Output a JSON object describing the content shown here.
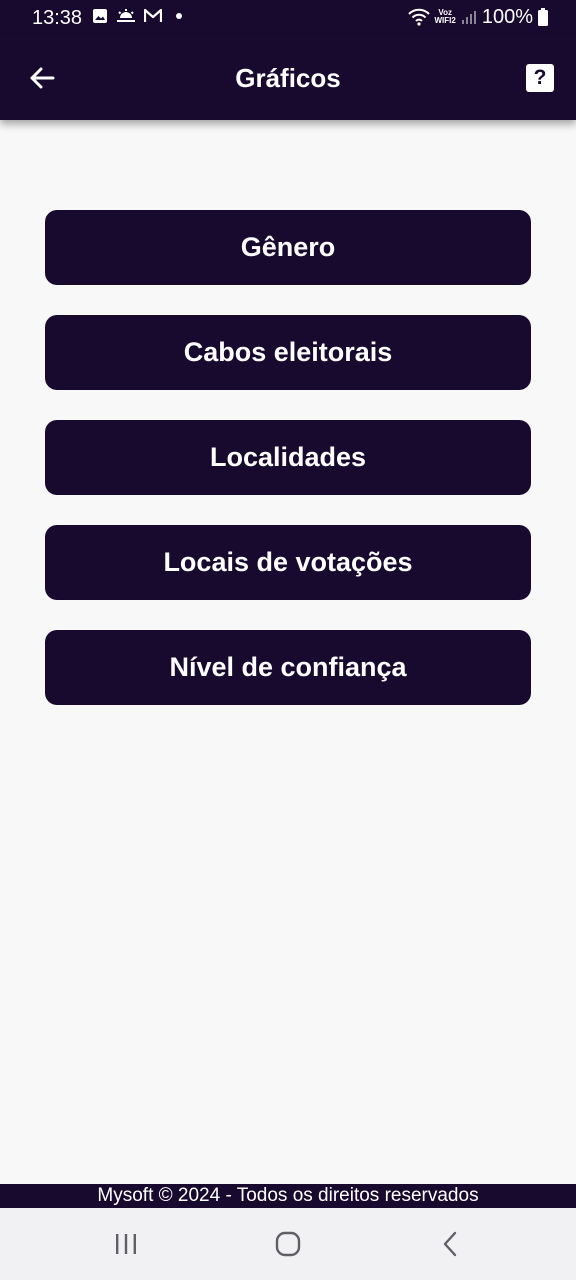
{
  "status_bar": {
    "time": "13:38",
    "battery": "100%",
    "network_label_top": "Voz",
    "network_label_bottom": "WIFI2",
    "icons": [
      "image-icon",
      "weather-icon",
      "gmail-icon",
      "notification-dot-icon",
      "wifi-icon",
      "signal-icon",
      "battery-icon"
    ]
  },
  "app_bar": {
    "title": "Gráficos",
    "help_label": "?"
  },
  "menu": {
    "items": [
      {
        "label": "Gênero"
      },
      {
        "label": "Cabos eleitorais"
      },
      {
        "label": "Localidades"
      },
      {
        "label": "Locais de votações"
      },
      {
        "label": "Nível de confiança"
      }
    ]
  },
  "footer": {
    "text": "Mysoft © 2024 - Todos os direitos reservados"
  },
  "colors": {
    "primary": "#170a2e",
    "background": "#f8f8f9",
    "on_primary": "#ffffff"
  }
}
